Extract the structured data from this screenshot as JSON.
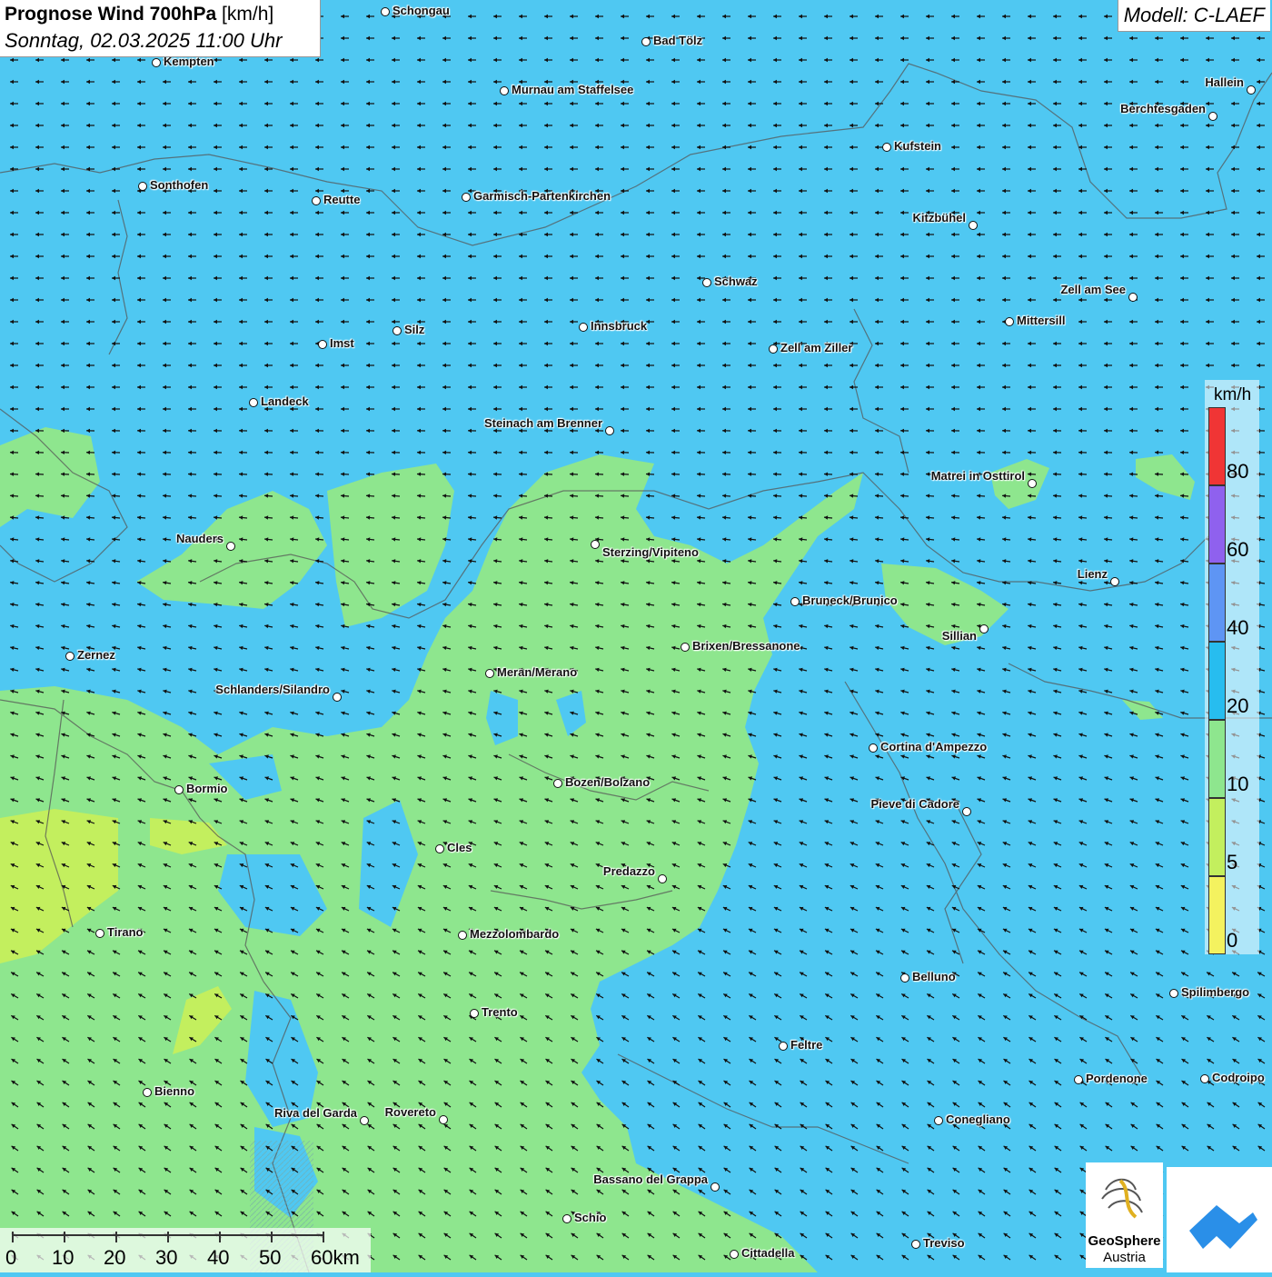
{
  "header": {
    "title_bold": "Prognose Wind 700hPa",
    "title_unit": "[km/h]",
    "subtitle": "Sonntag, 02.03.2025 11:00 Uhr",
    "model": "Modell: C-LAEF"
  },
  "legend": {
    "unit": "km/h",
    "levels": [
      {
        "label": "80",
        "color": "#f03535"
      },
      {
        "label": "60",
        "color": "#8f61ee"
      },
      {
        "label": "40",
        "color": "#5e95f4"
      },
      {
        "label": "20",
        "color": "#27bdef"
      },
      {
        "label": "10",
        "color": "#8ee68e"
      },
      {
        "label": "5",
        "color": "#c3ef5e"
      },
      {
        "label": "0",
        "color": "#f4f25f"
      }
    ]
  },
  "scalebar": {
    "labels": [
      "0",
      "10",
      "20",
      "30",
      "40",
      "50",
      "60km"
    ]
  },
  "logos": {
    "geosphere_line1": "GeoSphere",
    "geosphere_line2": "Austria"
  },
  "colors": {
    "bg_blue": "#4fc8f2",
    "calm_green": "#8ee68e",
    "calm_yellow": "#c3ef5e",
    "arrow": "#111111",
    "border": "#555555"
  },
  "cities": [
    {
      "name": "Schongau"
    },
    {
      "name": "Kempten"
    },
    {
      "name": "Bad Tölz"
    },
    {
      "name": "Murnau am Staffelsee"
    },
    {
      "name": "Hallein"
    },
    {
      "name": "Berchtesgaden"
    },
    {
      "name": "Kufstein"
    },
    {
      "name": "Sonthofen"
    },
    {
      "name": "Reutte"
    },
    {
      "name": "Garmisch-Partenkirchen"
    },
    {
      "name": "Kitzbühel"
    },
    {
      "name": "Schwaz"
    },
    {
      "name": "Zell am See"
    },
    {
      "name": "Mittersill"
    },
    {
      "name": "Innsbruck"
    },
    {
      "name": "Silz"
    },
    {
      "name": "Imst"
    },
    {
      "name": "Zell am Ziller"
    },
    {
      "name": "Landeck"
    },
    {
      "name": "Steinach am Brenner"
    },
    {
      "name": "Matrei in Osttirol"
    },
    {
      "name": "Nauders"
    },
    {
      "name": "Sterzing/Vipiteno"
    },
    {
      "name": "Lienz"
    },
    {
      "name": "Bruneck/Brunico"
    },
    {
      "name": "Sillian"
    },
    {
      "name": "Brixen/Bressanone"
    },
    {
      "name": "Zernez"
    },
    {
      "name": "Meran/Merano"
    },
    {
      "name": "Schlanders/Silandro"
    },
    {
      "name": "Cortina d'Ampezzo"
    },
    {
      "name": "Bozen/Bolzano"
    },
    {
      "name": "Bormio"
    },
    {
      "name": "Pieve di Cadore"
    },
    {
      "name": "Cles"
    },
    {
      "name": "Predazzo"
    },
    {
      "name": "Tirano"
    },
    {
      "name": "Mezzolombardo"
    },
    {
      "name": "Belluno"
    },
    {
      "name": "Spilimbergo"
    },
    {
      "name": "Trento"
    },
    {
      "name": "Feltre"
    },
    {
      "name": "Pordenone"
    },
    {
      "name": "Codroipo"
    },
    {
      "name": "Bienno"
    },
    {
      "name": "Riva del Garda"
    },
    {
      "name": "Rovereto"
    },
    {
      "name": "Conegliano"
    },
    {
      "name": "Bassano del Grappa"
    },
    {
      "name": "Schio"
    },
    {
      "name": "Treviso"
    },
    {
      "name": "Cittadella"
    }
  ]
}
